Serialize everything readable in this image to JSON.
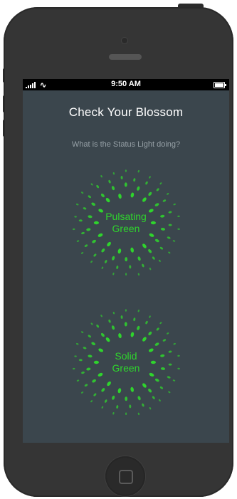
{
  "status_bar": {
    "time": "9:50 AM"
  },
  "screen": {
    "title": "Check Your Blossom",
    "subtitle": "What is the Status Light doing?",
    "options": [
      {
        "label": "Pulsating\nGreen"
      },
      {
        "label": "Solid\nGreen"
      }
    ]
  },
  "colors": {
    "screen_bg": "#3b464d",
    "accent_green": "#2fd42d",
    "phone_body": "#353535"
  }
}
